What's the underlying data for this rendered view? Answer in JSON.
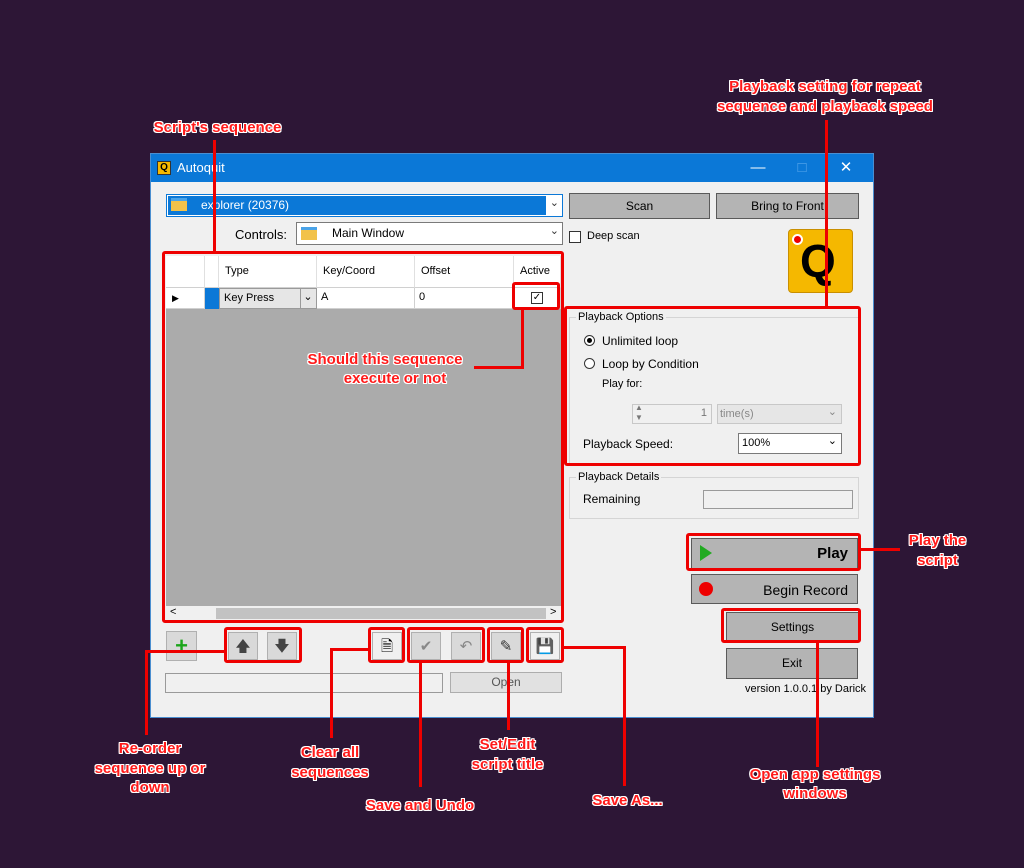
{
  "window": {
    "title": "Autoquit",
    "minimize_icon": "minimize-icon",
    "maximize_icon": "maximize-icon",
    "close_icon": "close-icon"
  },
  "process_select": {
    "value": "explorer (20376)"
  },
  "scan_button": "Scan",
  "bring_to_front_button": "Bring to Front",
  "controls_label": "Controls:",
  "controls_select": {
    "value": "Main Window"
  },
  "deep_scan": {
    "label": "Deep scan",
    "checked": false
  },
  "grid": {
    "columns": [
      "Type",
      "Key/Coord",
      "Offset",
      "Active"
    ],
    "rows": [
      {
        "type": "Key Press",
        "key": "A",
        "offset": "0",
        "active": true
      }
    ]
  },
  "playback_options": {
    "title": "Playback Options",
    "unlimited_loop": "Unlimited loop",
    "loop_by_condition": "Loop by Condition",
    "play_for_label": "Play for:",
    "play_for_value": "1",
    "play_for_unit": "time(s)",
    "speed_label": "Playback Speed:",
    "speed_value": "100%",
    "selected": "unlimited_loop"
  },
  "playback_details": {
    "title": "Playback Details",
    "remaining_label": "Remaining",
    "remaining_value": ""
  },
  "play_button": "Play",
  "record_button": "Begin Record",
  "settings_button": "Settings",
  "exit_button": "Exit",
  "open_button": "Open",
  "version_text": "version 1.0.0.1 by Darick",
  "colors": {
    "accent": "#0b78d7",
    "annotation": "#ff1a1a",
    "background": "#2d1636",
    "play_icon": "#22aa22",
    "record_icon": "#e00000"
  },
  "annotations": {
    "script_sequence": "Script's sequence",
    "playback_setting_1": "Playback setting for repeat",
    "playback_setting_2": "sequence and playback speed",
    "should_execute_1": "Should this sequence",
    "should_execute_2": "execute or not",
    "play_script_1": "Play the",
    "play_script_2": "script",
    "reorder_1": "Re-order",
    "reorder_2": "sequence up or",
    "reorder_3": "down",
    "clear_all_1": "Clear all",
    "clear_all_2": "sequences",
    "save_undo": "Save and Undo",
    "set_edit_1": "Set/Edit",
    "set_edit_2": "script title",
    "save_as": "Save As...",
    "open_settings_1": "Open app settings",
    "open_settings_2": "windows"
  }
}
